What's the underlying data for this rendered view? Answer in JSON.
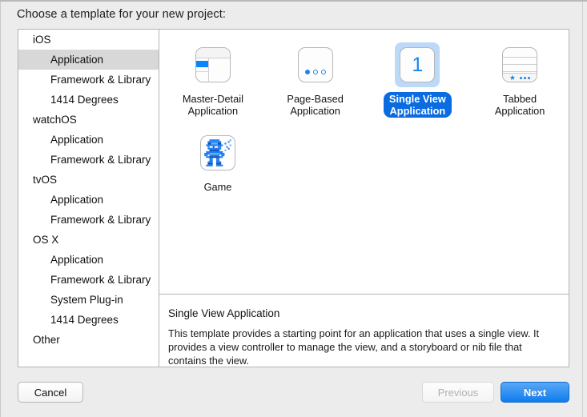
{
  "dialog": {
    "prompt": "Choose a template for your new project:"
  },
  "sidebar": {
    "items": [
      {
        "label": "iOS",
        "type": "group",
        "selected": false
      },
      {
        "label": "Application",
        "type": "child",
        "selected": true
      },
      {
        "label": "Framework & Library",
        "type": "child",
        "selected": false
      },
      {
        "label": "1414 Degrees",
        "type": "child",
        "selected": false
      },
      {
        "label": "watchOS",
        "type": "group",
        "selected": false
      },
      {
        "label": "Application",
        "type": "child",
        "selected": false
      },
      {
        "label": "Framework & Library",
        "type": "child",
        "selected": false
      },
      {
        "label": "tvOS",
        "type": "group",
        "selected": false
      },
      {
        "label": "Application",
        "type": "child",
        "selected": false
      },
      {
        "label": "Framework & Library",
        "type": "child",
        "selected": false
      },
      {
        "label": "OS X",
        "type": "group",
        "selected": false
      },
      {
        "label": "Application",
        "type": "child",
        "selected": false
      },
      {
        "label": "Framework & Library",
        "type": "child",
        "selected": false
      },
      {
        "label": "System Plug-in",
        "type": "child",
        "selected": false
      },
      {
        "label": "1414 Degrees",
        "type": "child",
        "selected": false
      },
      {
        "label": "Other",
        "type": "group",
        "selected": false
      }
    ]
  },
  "templates": {
    "items": [
      {
        "label": "Master-Detail\nApplication",
        "icon": "master-detail-icon",
        "selected": false
      },
      {
        "label": "Page-Based\nApplication",
        "icon": "page-based-icon",
        "selected": false
      },
      {
        "label": "Single View\nApplication",
        "icon": "single-view-icon",
        "selected": true
      },
      {
        "label": "Tabbed\nApplication",
        "icon": "tabbed-icon",
        "selected": false
      },
      {
        "label": "Game",
        "icon": "game-icon",
        "selected": false
      }
    ],
    "single_view_number": "1"
  },
  "description": {
    "title": "Single View Application",
    "body": "This template provides a starting point for an application that uses a single view. It provides a view controller to manage the view, and a storyboard or nib file that contains the view."
  },
  "buttons": {
    "cancel": "Cancel",
    "previous": "Previous",
    "next": "Next"
  },
  "colors": {
    "accent_blue": "#0a6ce0",
    "icon_blue": "#1787f0",
    "selection_gray": "#d8d8d8",
    "selection_light_blue": "#bcd9f8"
  }
}
